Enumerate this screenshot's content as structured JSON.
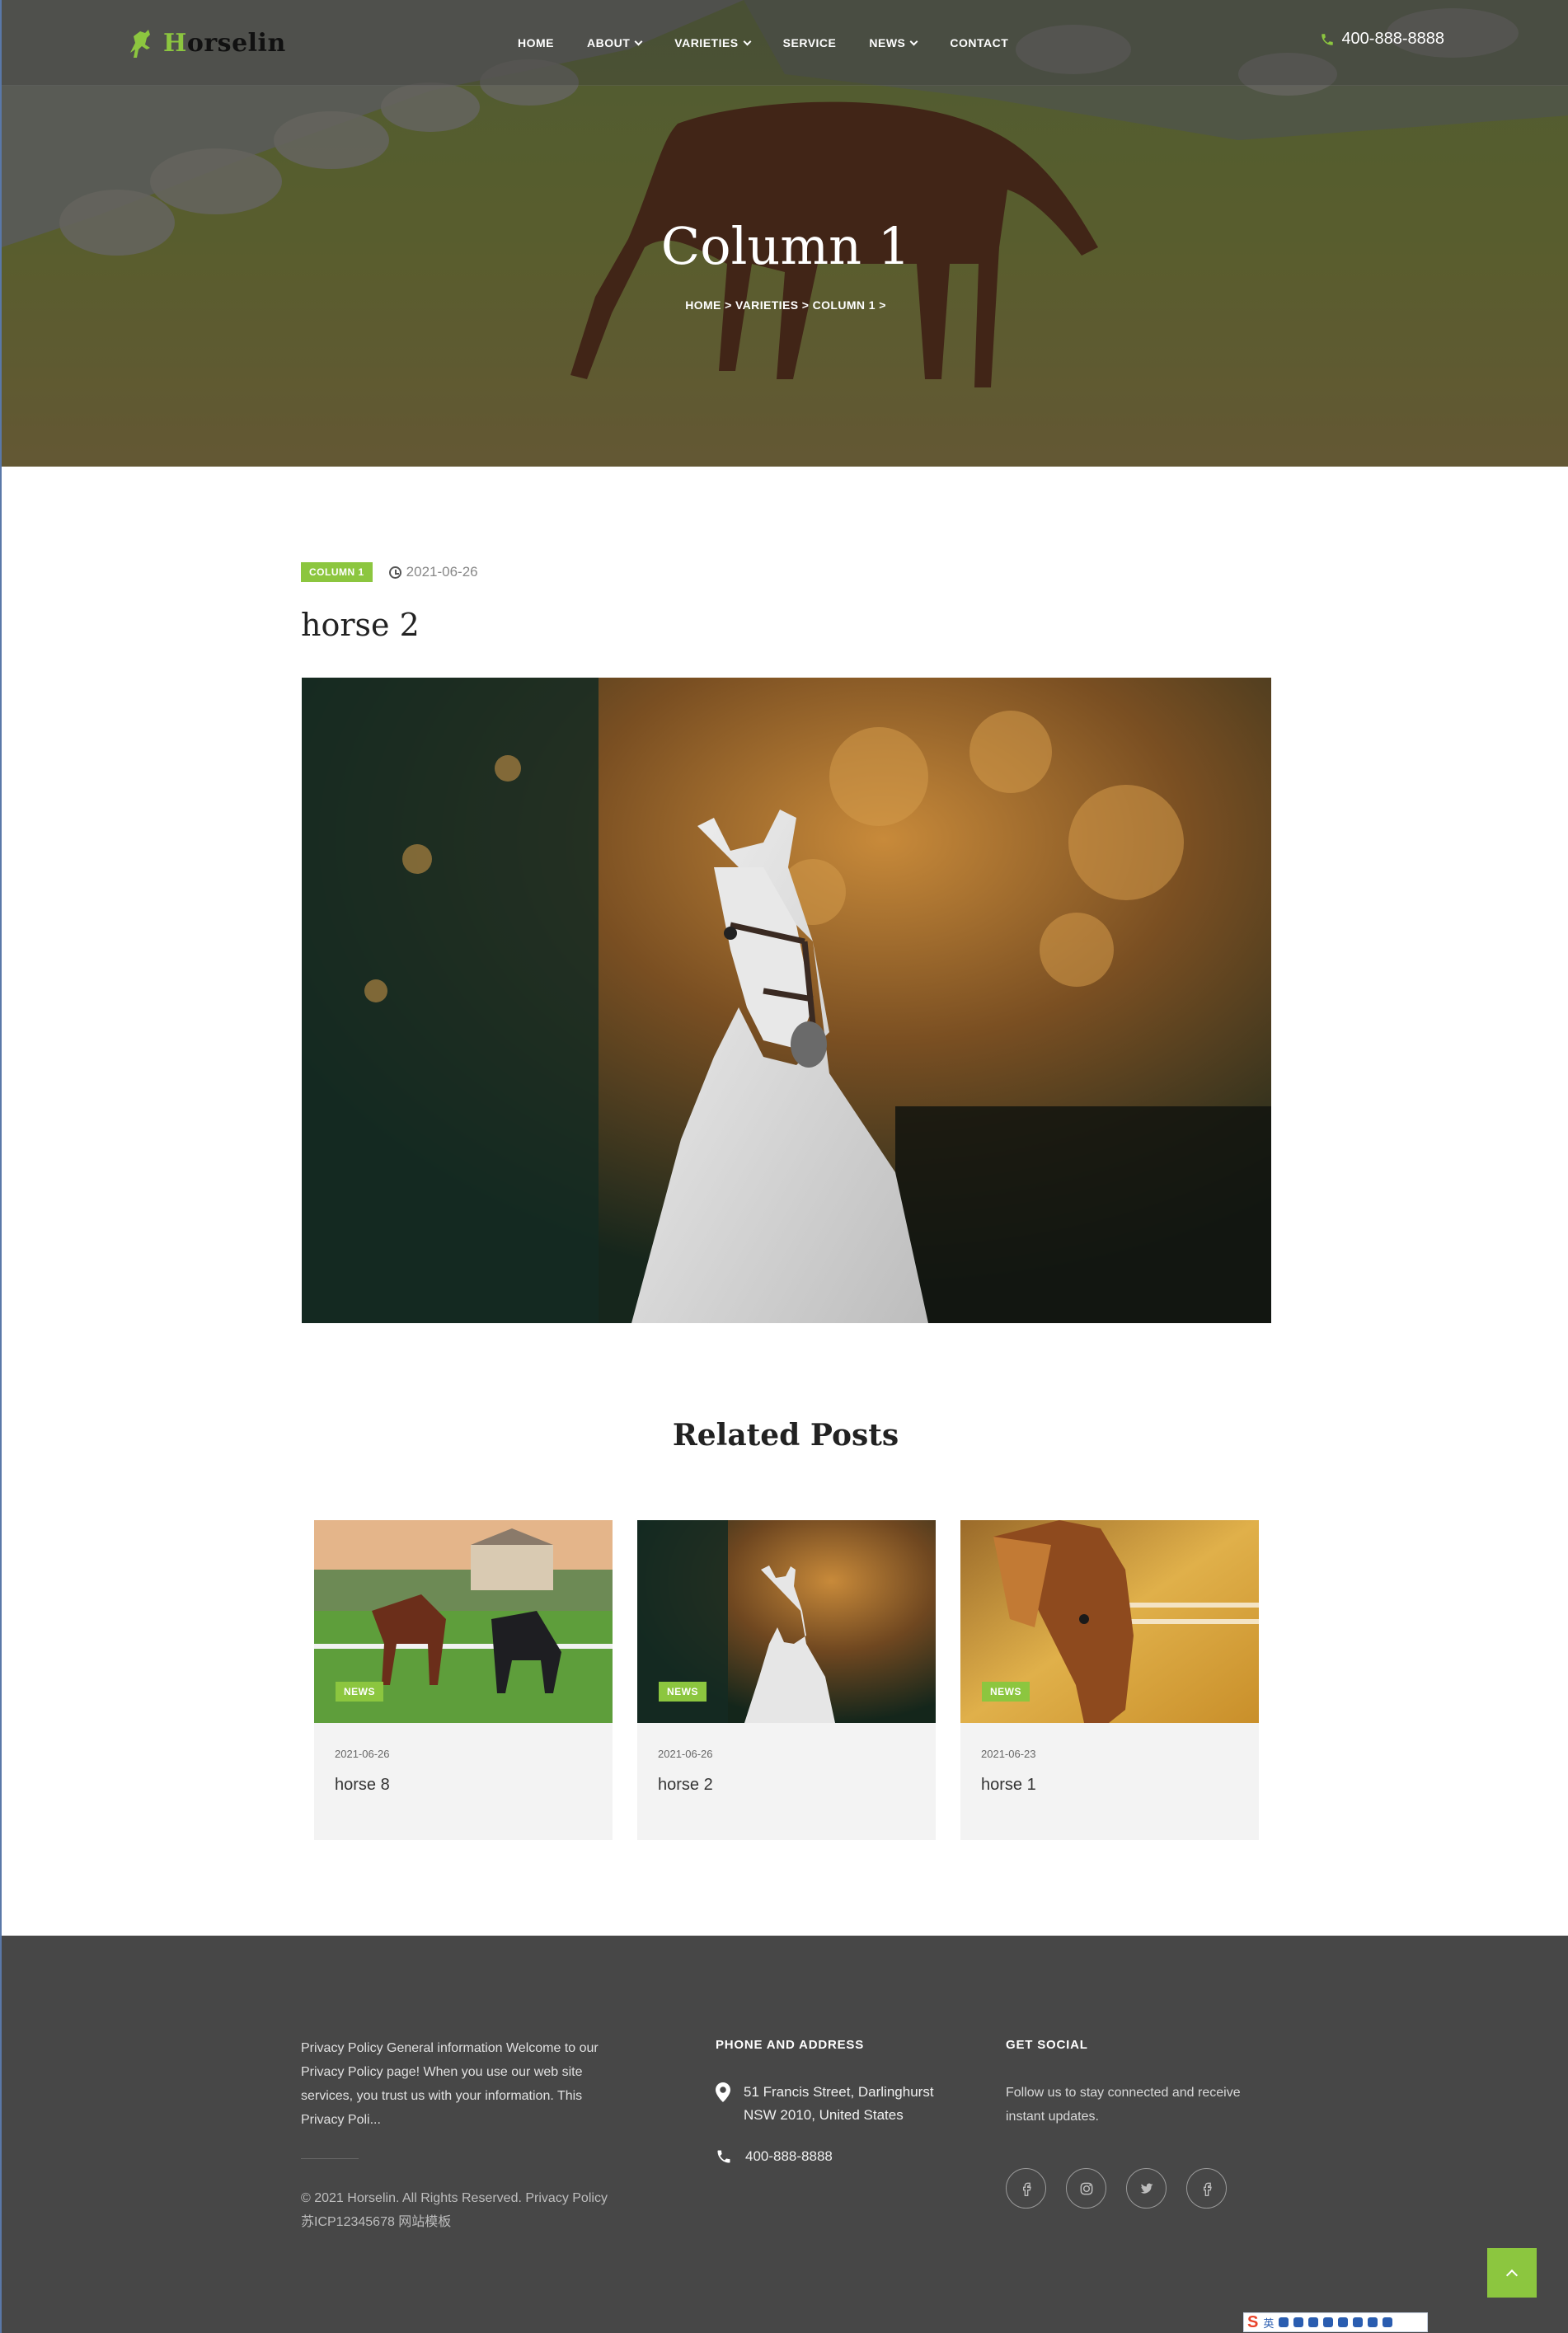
{
  "header": {
    "logo_initial": "H",
    "logo_rest": "orselin",
    "nav": [
      {
        "label": "HOME"
      },
      {
        "label": "ABOUT"
      },
      {
        "label": "VARIETIES"
      },
      {
        "label": "SERVICE"
      },
      {
        "label": "NEWS"
      },
      {
        "label": "CONTACT"
      }
    ],
    "phone": "400-888-8888"
  },
  "hero": {
    "title": "Column 1",
    "breadcrumb": [
      "HOME",
      "VARIETIES",
      "COLUMN 1"
    ],
    "breadcrumb_sep": ">"
  },
  "post": {
    "category": "COLUMN 1",
    "date": "2021-06-26",
    "title": "horse 2"
  },
  "related": {
    "title": "Related Posts",
    "items": [
      {
        "badge": "NEWS",
        "date": "2021-06-26",
        "title": "horse 8"
      },
      {
        "badge": "NEWS",
        "date": "2021-06-26",
        "title": "horse 2"
      },
      {
        "badge": "NEWS",
        "date": "2021-06-23",
        "title": "horse 1"
      }
    ]
  },
  "footer": {
    "about": "Privacy Policy General information Welcome to our Privacy Policy page! When you use our web site services, you trust us with your information. This Privacy Poli...",
    "copyright": "© 2021 Horselin. All Rights Reserved. Privacy Policy 苏ICP12345678 网站模板",
    "contact_heading": "PHONE AND ADDRESS",
    "address": "51 Francis Street, Darlinghurst NSW 2010, United States",
    "phone": "400-888-8888",
    "social_heading": "GET SOCIAL",
    "social_text": "Follow us to stay connected and receive instant updates.",
    "socials": [
      "facebook-icon",
      "instagram-icon",
      "twitter-icon",
      "facebook-icon"
    ]
  },
  "ime": {
    "label": "英"
  },
  "colors": {
    "accent": "#8cc63f",
    "footer_bg": "#474747"
  }
}
